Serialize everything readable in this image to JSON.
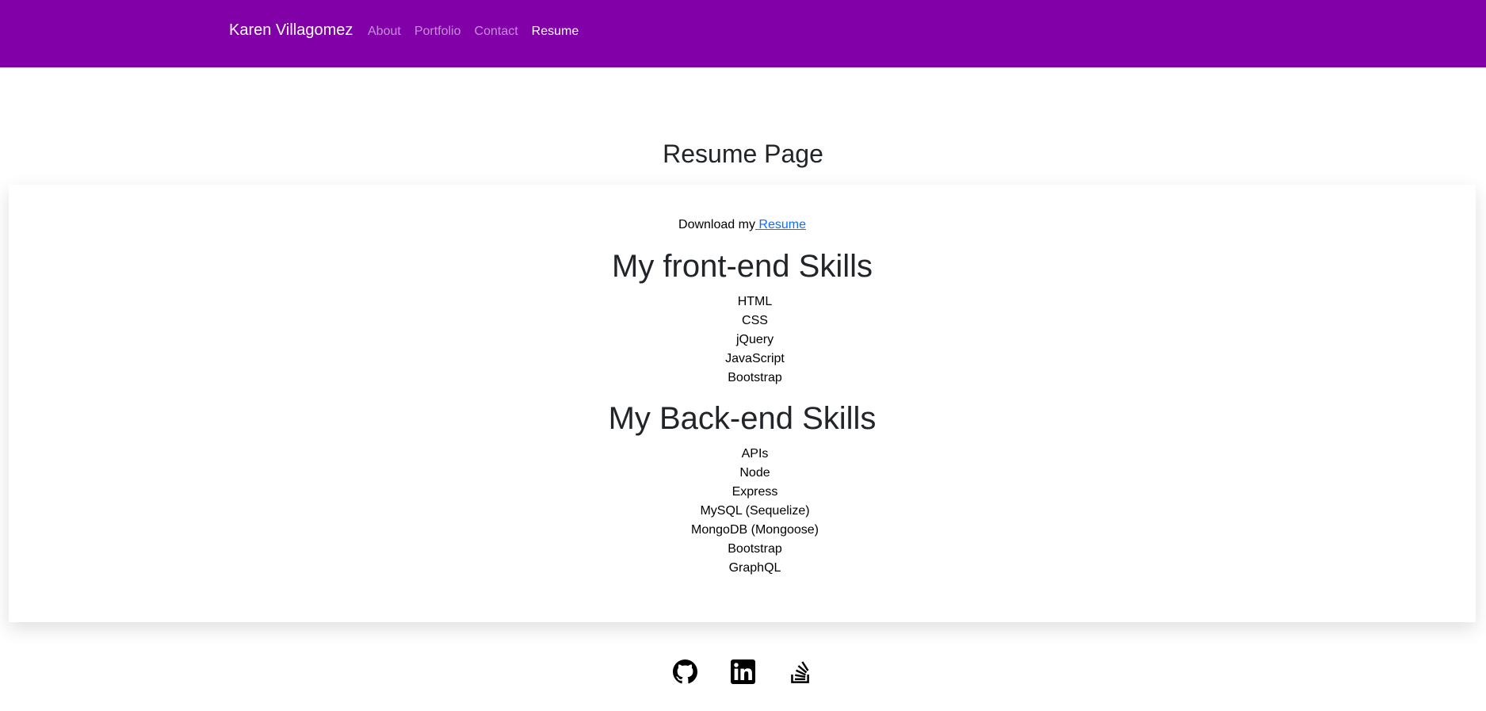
{
  "nav": {
    "brand": "Karen Villagomez",
    "links": [
      {
        "label": "About",
        "active": false
      },
      {
        "label": "Portfolio",
        "active": false
      },
      {
        "label": "Contact",
        "active": false
      },
      {
        "label": "Resume",
        "active": true
      }
    ],
    "background": "#8200a8"
  },
  "page": {
    "title": "Resume Page"
  },
  "resume": {
    "download_prefix": "Download my",
    "download_link": " Resume"
  },
  "frontend": {
    "heading": "My front-end Skills",
    "skills": [
      "HTML",
      "CSS",
      "jQuery",
      "JavaScript",
      "Bootstrap"
    ]
  },
  "backend": {
    "heading": "My Back-end Skills",
    "skills": [
      "APIs",
      "Node",
      "Express",
      "MySQL (Sequelize)",
      "MongoDB (Mongoose)",
      "Bootstrap",
      "GraphQL"
    ]
  },
  "footer": {
    "icons": [
      "github-icon",
      "linkedin-icon",
      "stack-overflow-icon"
    ]
  },
  "colors": {
    "accent": "#8200a8",
    "link": "#0d6efd"
  }
}
